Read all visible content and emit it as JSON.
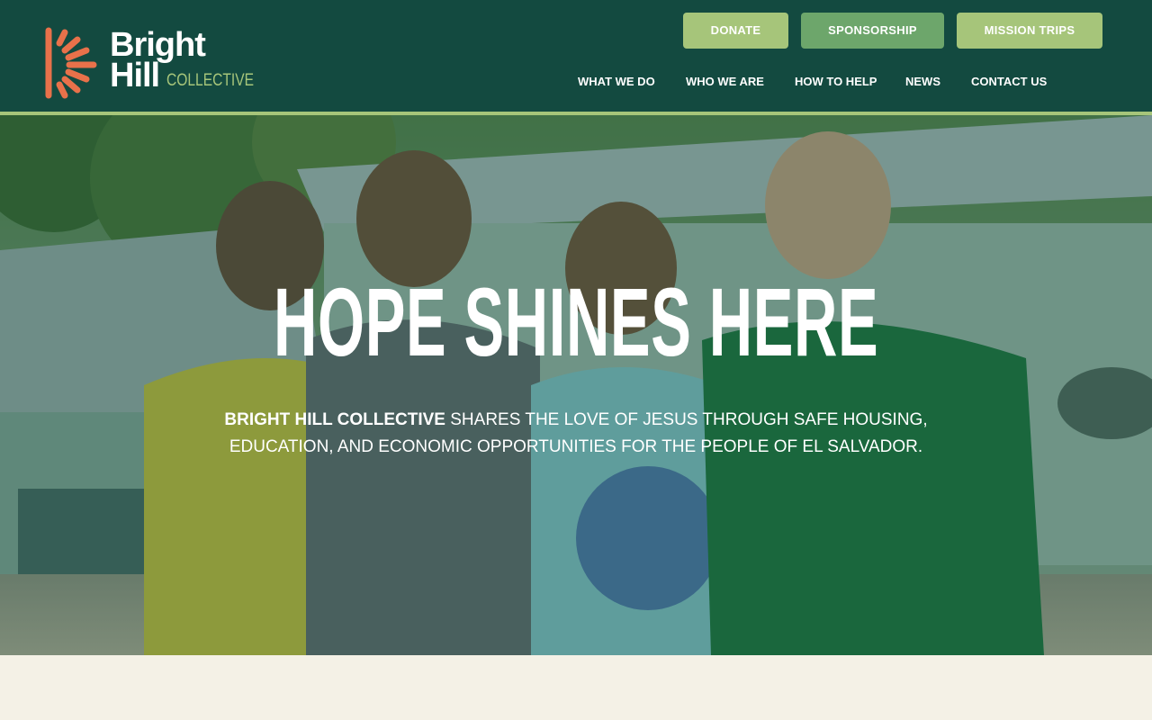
{
  "brand": {
    "logo_line1": "Bright",
    "logo_line2": "Hill",
    "logo_line3": "COLLECTIVE",
    "logo_icon": "sunburst-icon",
    "colors": {
      "header_bg": "#134a40",
      "accent_green": "#a6c57a",
      "mid_green": "#6da66b",
      "logo_orange": "#e8714a",
      "page_bg": "#f4f1e6"
    }
  },
  "header": {
    "cta_buttons": [
      {
        "label": "DONATE"
      },
      {
        "label": "SPONSORSHIP"
      },
      {
        "label": "MISSION TRIPS"
      }
    ],
    "nav": [
      {
        "label": "WHAT WE DO"
      },
      {
        "label": "WHO WE ARE"
      },
      {
        "label": "HOW TO HELP"
      },
      {
        "label": "NEWS"
      },
      {
        "label": "CONTACT US"
      }
    ]
  },
  "hero": {
    "headline": "HOPE SHINES HERE",
    "tagline_bold": "BRIGHT HILL COLLECTIVE",
    "tagline_rest": " SHARES THE LOVE OF JESUS THROUGH SAFE HOUSING, EDUCATION, AND ECONOMIC OPPORTUNITIES FOR THE PEOPLE OF EL SALVADOR."
  }
}
